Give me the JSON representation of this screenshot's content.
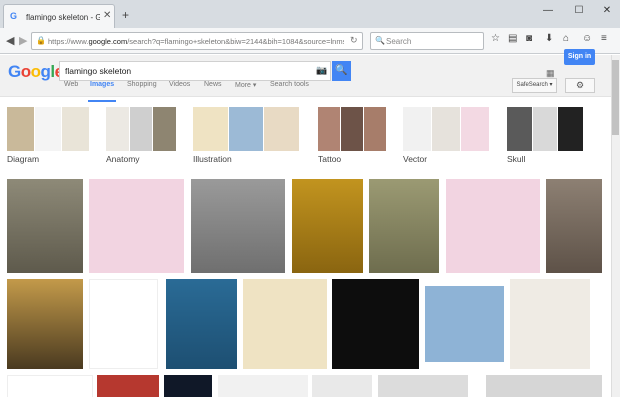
{
  "browser": {
    "tab_title": "flamingo skeleton - Googl…",
    "tab_favicon": "G",
    "url_prefix": "https://www.",
    "url_domain": "google.com",
    "url_rest": "/search?q=flamingo+skeleton&biw=2144&bih=1084&source=lnms&tb",
    "search_placeholder": "Search"
  },
  "google": {
    "query": "flamingo skeleton",
    "sign_in": "Sign in",
    "tabs": [
      "Web",
      "Images",
      "Shopping",
      "Videos",
      "News",
      "More ▾",
      "Search tools"
    ],
    "safe_search": "SafeSearch ▾"
  },
  "related": [
    "Diagram",
    "Anatomy",
    "Illustration",
    "Tattoo",
    "Vector",
    "Skull"
  ],
  "colors": {
    "accent": "#4285f4"
  }
}
